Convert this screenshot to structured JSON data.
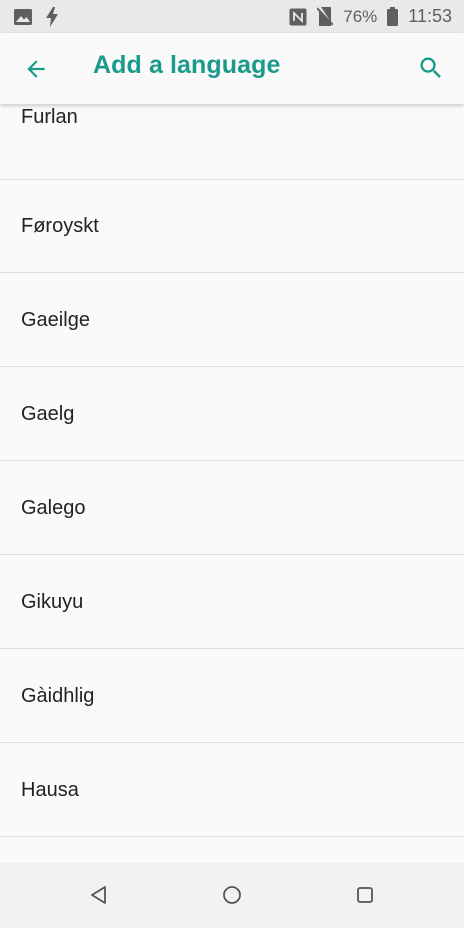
{
  "status_bar": {
    "battery_percent": "76%",
    "time": "11:53",
    "icons_left": [
      "image-icon",
      "charging-bolt-icon"
    ],
    "icons_right": [
      "nfc-icon",
      "no-sim-icon",
      "battery-icon"
    ]
  },
  "app_bar": {
    "title": "Add a language",
    "back_icon": "arrow-back-icon",
    "search_icon": "search-icon",
    "accent_color": "#1a9a8a"
  },
  "languages": [
    "Furlan",
    "Føroyskt",
    "Gaeilge",
    "Gaelg",
    "Galego",
    "Gikuyu",
    "Gàidhlig",
    "Hausa"
  ],
  "nav_bar": {
    "buttons": [
      "back-triangle-icon",
      "home-circle-icon",
      "recents-square-icon"
    ]
  }
}
